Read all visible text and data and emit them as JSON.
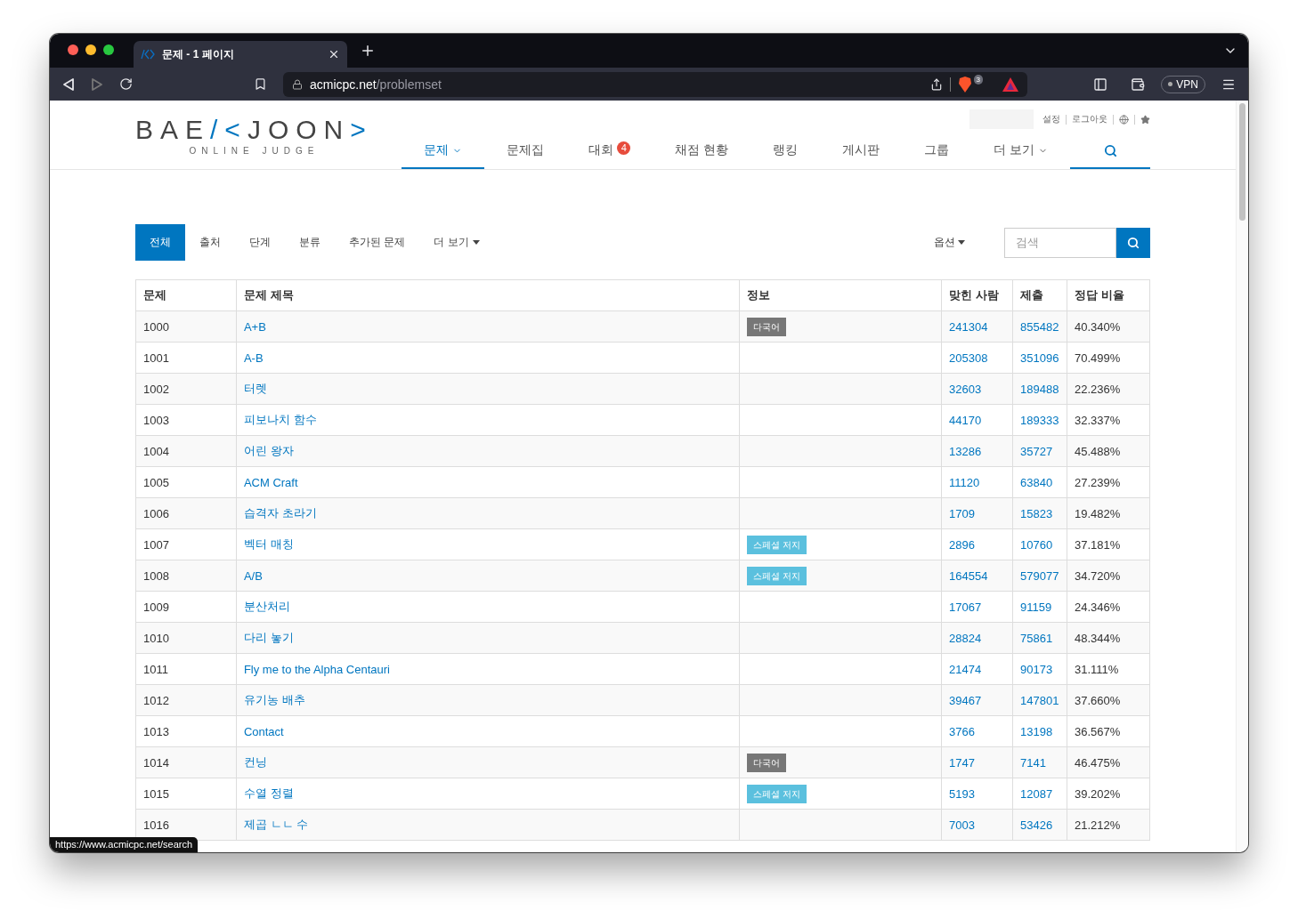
{
  "browser": {
    "tab_title": "문제 - 1 페이지",
    "url_host": "acmicpc.net",
    "url_path": "/problemset",
    "shield_count": "3",
    "vpn": "VPN",
    "status_url": "https://www.acmicpc.net/search"
  },
  "header": {
    "logo": {
      "left": "BAE",
      "mark": "/<",
      "right": "JOON",
      "end": ">",
      "subtitle": "ONLINE JUDGE"
    },
    "user_links": [
      "설정",
      "로그아웃"
    ],
    "nav": [
      {
        "kind": "link",
        "label": "문제",
        "selected": true,
        "dropdown": true
      },
      {
        "kind": "link",
        "label": "문제집",
        "selected": false,
        "dropdown": false
      },
      {
        "kind": "link",
        "label": "대회",
        "selected": false,
        "dropdown": false,
        "badge": "4"
      },
      {
        "kind": "link",
        "label": "채점 현황",
        "selected": false,
        "dropdown": false
      },
      {
        "kind": "link",
        "label": "랭킹",
        "selected": false,
        "dropdown": false
      },
      {
        "kind": "link",
        "label": "게시판",
        "selected": false,
        "dropdown": false
      },
      {
        "kind": "link",
        "label": "그룹",
        "selected": false,
        "dropdown": false
      },
      {
        "kind": "link",
        "label": "더 보기",
        "selected": false,
        "dropdown": true
      },
      {
        "kind": "search",
        "selected": true,
        "dropdown": false
      }
    ]
  },
  "filters": {
    "tabs": [
      {
        "label": "전체",
        "selected": true,
        "dropdown": false
      },
      {
        "label": "출처",
        "selected": false,
        "dropdown": false
      },
      {
        "label": "단계",
        "selected": false,
        "dropdown": false
      },
      {
        "label": "분류",
        "selected": false,
        "dropdown": false
      },
      {
        "label": "추가된 문제",
        "selected": false,
        "dropdown": false
      },
      {
        "label": "더 보기",
        "selected": false,
        "dropdown": true
      }
    ],
    "options": "옵션",
    "search_placeholder": "검색"
  },
  "table": {
    "columns": [
      "문제",
      "문제 제목",
      "정보",
      "맞힌 사람",
      "제출",
      "정답 비율"
    ],
    "rows": [
      {
        "id": "1000",
        "title": "A+B",
        "tags": [
          {
            "kind": "multilang",
            "text": "다국어"
          }
        ],
        "solved": "241304",
        "submissions": "855482",
        "ratio": "40.340%"
      },
      {
        "id": "1001",
        "title": "A-B",
        "tags": [],
        "solved": "205308",
        "submissions": "351096",
        "ratio": "70.499%"
      },
      {
        "id": "1002",
        "title": "터렛",
        "tags": [],
        "solved": "32603",
        "submissions": "189488",
        "ratio": "22.236%"
      },
      {
        "id": "1003",
        "title": "피보나치 함수",
        "tags": [],
        "solved": "44170",
        "submissions": "189333",
        "ratio": "32.337%"
      },
      {
        "id": "1004",
        "title": "어린 왕자",
        "tags": [],
        "solved": "13286",
        "submissions": "35727",
        "ratio": "45.488%"
      },
      {
        "id": "1005",
        "title": "ACM Craft",
        "tags": [],
        "solved": "11120",
        "submissions": "63840",
        "ratio": "27.239%"
      },
      {
        "id": "1006",
        "title": "습격자 초라기",
        "tags": [],
        "solved": "1709",
        "submissions": "15823",
        "ratio": "19.482%"
      },
      {
        "id": "1007",
        "title": "벡터 매칭",
        "tags": [
          {
            "kind": "special",
            "text": "스페셜 저지"
          }
        ],
        "solved": "2896",
        "submissions": "10760",
        "ratio": "37.181%"
      },
      {
        "id": "1008",
        "title": "A/B",
        "tags": [
          {
            "kind": "special",
            "text": "스페셜 저지"
          }
        ],
        "solved": "164554",
        "submissions": "579077",
        "ratio": "34.720%"
      },
      {
        "id": "1009",
        "title": "분산처리",
        "tags": [],
        "solved": "17067",
        "submissions": "91159",
        "ratio": "24.346%"
      },
      {
        "id": "1010",
        "title": "다리 놓기",
        "tags": [],
        "solved": "28824",
        "submissions": "75861",
        "ratio": "48.344%"
      },
      {
        "id": "1011",
        "title": "Fly me to the Alpha Centauri",
        "tags": [],
        "solved": "21474",
        "submissions": "90173",
        "ratio": "31.111%"
      },
      {
        "id": "1012",
        "title": "유기농 배추",
        "tags": [],
        "solved": "39467",
        "submissions": "147801",
        "ratio": "37.660%"
      },
      {
        "id": "1013",
        "title": "Contact",
        "tags": [],
        "solved": "3766",
        "submissions": "13198",
        "ratio": "36.567%"
      },
      {
        "id": "1014",
        "title": "컨닝",
        "tags": [
          {
            "kind": "multilang",
            "text": "다국어"
          }
        ],
        "solved": "1747",
        "submissions": "7141",
        "ratio": "46.475%"
      },
      {
        "id": "1015",
        "title": "수열 정렬",
        "tags": [
          {
            "kind": "special",
            "text": "스페셜 저지"
          }
        ],
        "solved": "5193",
        "submissions": "12087",
        "ratio": "39.202%"
      },
      {
        "id": "1016",
        "title": "제곱 ㄴㄴ 수",
        "tags": [],
        "solved": "7003",
        "submissions": "53426",
        "ratio": "21.212%"
      }
    ]
  }
}
